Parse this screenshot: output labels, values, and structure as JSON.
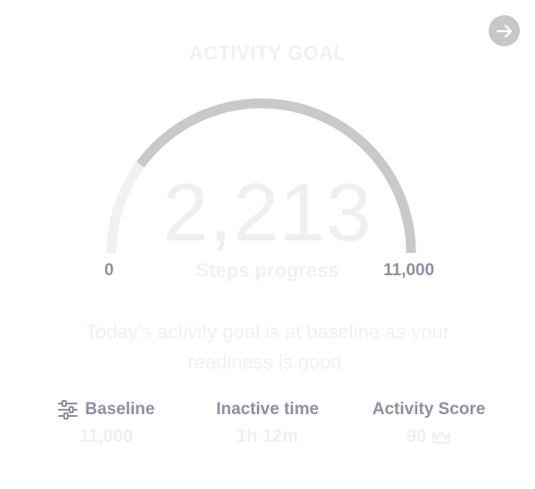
{
  "header": {
    "title": "ACTIVITY GOAL",
    "next_icon": "arrow-right-icon"
  },
  "gauge": {
    "value": "2,213",
    "label": "Steps progress",
    "min_label": "0",
    "max_label": "11,000",
    "value_numeric": 2213,
    "max_numeric": 11000,
    "track_color": "#f1f1f3",
    "fill_color": "#c9c9c9"
  },
  "message": "Today’s activity goal is at baseline as your readiness is good.",
  "stats": [
    {
      "label": "Baseline",
      "value": "11,000",
      "icon": "sliders-icon"
    },
    {
      "label": "Inactive time",
      "value": "1h 12m"
    },
    {
      "label": "Activity Score",
      "value": "90",
      "icon": "crown-icon"
    }
  ]
}
